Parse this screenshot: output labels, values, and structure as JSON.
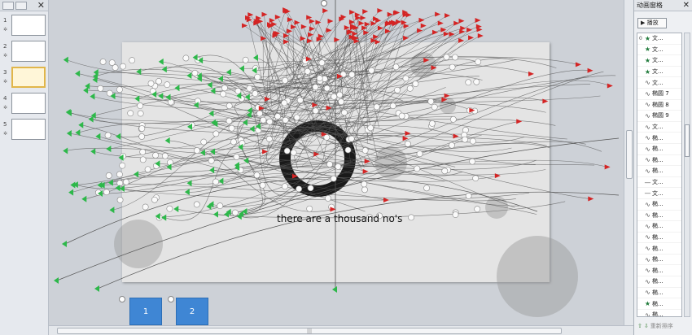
{
  "thumbs": {
    "close_icon": "✕",
    "slides": [
      {
        "num": "1",
        "fx": "✲"
      },
      {
        "num": "2",
        "fx": "✲"
      },
      {
        "num": "3",
        "fx": "✲",
        "active": true
      },
      {
        "num": "4",
        "fx": "✲"
      },
      {
        "num": "5",
        "fx": "✲"
      }
    ]
  },
  "slide": {
    "caption": "there are a thousand no's"
  },
  "hud": {
    "box1": "1",
    "box2": "2"
  },
  "anim_pane": {
    "title": "动画窗格",
    "close_icon": "✕",
    "play_label": "▶ 播放",
    "items": [
      {
        "num": "0",
        "icon": "star",
        "label": "文..."
      },
      {
        "num": "",
        "icon": "star",
        "label": "文..."
      },
      {
        "num": "",
        "icon": "star",
        "label": "文..."
      },
      {
        "num": "",
        "icon": "star",
        "label": "文..."
      },
      {
        "num": "",
        "icon": "path",
        "label": "文..."
      },
      {
        "num": "",
        "icon": "path",
        "label": "椭圆 7"
      },
      {
        "num": "",
        "icon": "path",
        "label": "椭圆 8"
      },
      {
        "num": "",
        "icon": "path",
        "label": "椭圆 9"
      },
      {
        "num": "",
        "icon": "path",
        "label": "文..."
      },
      {
        "num": "",
        "icon": "path",
        "label": "椭..."
      },
      {
        "num": "",
        "icon": "path",
        "label": "椭..."
      },
      {
        "num": "",
        "icon": "path",
        "label": "椭..."
      },
      {
        "num": "",
        "icon": "path",
        "label": "椭..."
      },
      {
        "num": "",
        "icon": "line",
        "label": "文..."
      },
      {
        "num": "",
        "icon": "line",
        "label": "文..."
      },
      {
        "num": "",
        "icon": "path",
        "label": "椭..."
      },
      {
        "num": "",
        "icon": "path",
        "label": "椭..."
      },
      {
        "num": "",
        "icon": "path",
        "label": "椭..."
      },
      {
        "num": "",
        "icon": "path",
        "label": "椭..."
      },
      {
        "num": "",
        "icon": "path",
        "label": "椭..."
      },
      {
        "num": "",
        "icon": "path",
        "label": "椭..."
      },
      {
        "num": "",
        "icon": "path",
        "label": "椭..."
      },
      {
        "num": "",
        "icon": "path",
        "label": "椭..."
      },
      {
        "num": "",
        "icon": "path",
        "label": "椭..."
      },
      {
        "num": "",
        "icon": "star",
        "label": "椭..."
      },
      {
        "num": "",
        "icon": "path",
        "label": "椭..."
      }
    ],
    "reorder_label": "重新排序"
  },
  "colors": {
    "start_marker": "#2db84a",
    "end_marker": "#d42424",
    "path_line": "#555555",
    "hud_box": "#3f86d4"
  }
}
